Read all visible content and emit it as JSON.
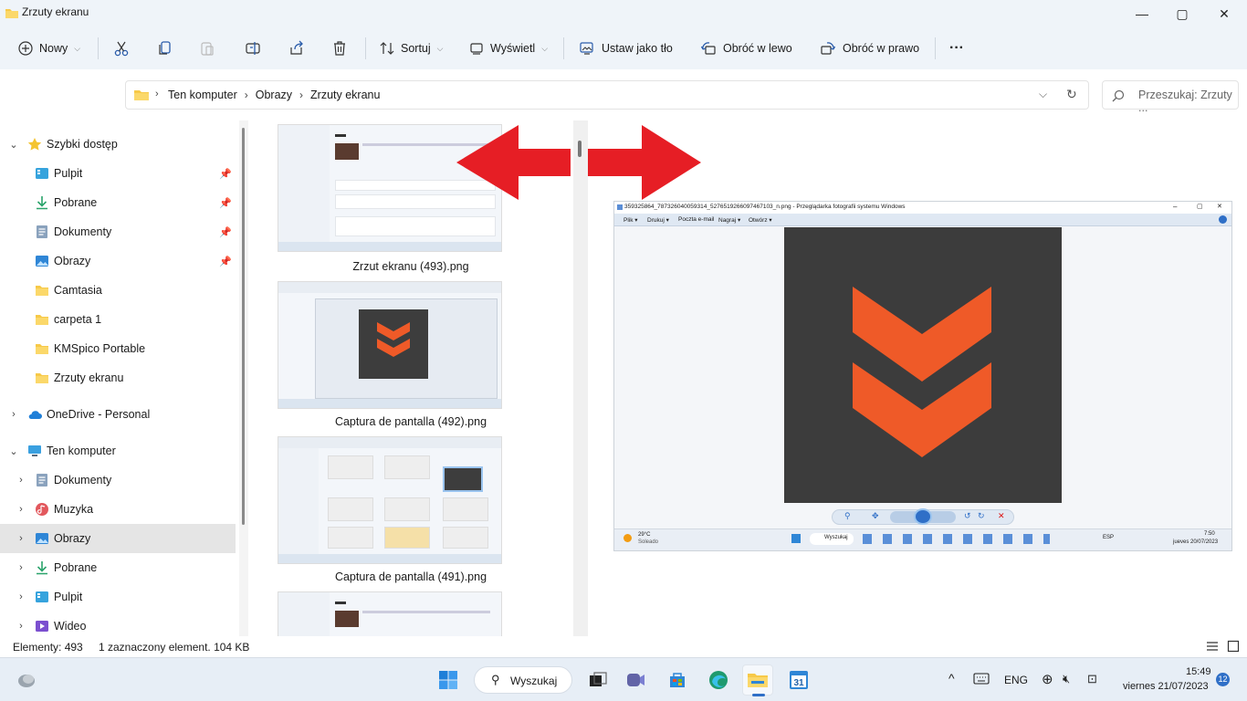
{
  "window": {
    "title": "Zrzuty ekranu",
    "minimize_glyph": "—",
    "maximize_glyph": "▢",
    "close_glyph": "✕"
  },
  "toolbar": {
    "new_label": "Nowy",
    "sort_label": "Sortuj",
    "view_label": "Wyświetl",
    "set_background_label": "Ustaw jako tło",
    "rotate_left_label": "Obróć w lewo",
    "rotate_right_label": "Obróć w prawo",
    "more_label": "···"
  },
  "address": {
    "crumbs": [
      "Ten komputer",
      "Obrazy",
      "Zrzuty ekranu"
    ],
    "search_placeholder": "Przeszukaj: Zrzuty ..."
  },
  "sidebar": {
    "quick_access": {
      "label": "Szybki dostęp",
      "items": [
        {
          "label": "Pulpit",
          "icon": "desktop-icon",
          "pinned": true
        },
        {
          "label": "Pobrane",
          "icon": "download-icon",
          "pinned": true
        },
        {
          "label": "Dokumenty",
          "icon": "documents-icon",
          "pinned": true
        },
        {
          "label": "Obrazy",
          "icon": "pictures-icon",
          "pinned": true
        },
        {
          "label": "Camtasia",
          "icon": "folder-icon",
          "pinned": false
        },
        {
          "label": "carpeta 1",
          "icon": "folder-icon",
          "pinned": false
        },
        {
          "label": "KMSpico Portable",
          "icon": "folder-icon",
          "pinned": false
        },
        {
          "label": "Zrzuty ekranu",
          "icon": "folder-icon",
          "pinned": false
        }
      ]
    },
    "onedrive": {
      "label": "OneDrive - Personal"
    },
    "this_pc": {
      "label": "Ten komputer",
      "items": [
        {
          "label": "Dokumenty",
          "icon": "documents-icon"
        },
        {
          "label": "Muzyka",
          "icon": "music-icon"
        },
        {
          "label": "Obrazy",
          "icon": "pictures-icon",
          "selected": true
        },
        {
          "label": "Pobrane",
          "icon": "download-icon"
        },
        {
          "label": "Pulpit",
          "icon": "desktop-icon"
        },
        {
          "label": "Wideo",
          "icon": "video-icon"
        }
      ]
    }
  },
  "files": [
    {
      "name": "Zrzut ekranu (493).png"
    },
    {
      "name": "Captura de pantalla (492).png"
    },
    {
      "name": "Captura de pantalla (491).png"
    },
    {
      "name": ""
    }
  ],
  "preview": {
    "viewer_title": "359325864_787326040059314_5276519266097467103_n.png - Przeglądarka fotografii systemu Windows",
    "menu": [
      "Plik ▾",
      "Drukuj ▾",
      "Poczta e-mail",
      "Nagraj ▾",
      "Otwórz ▾"
    ],
    "weather_temp": "29°C",
    "weather_desc": "Soleado",
    "search_label": "Wyszukaj",
    "lang": "ESP",
    "time": "7:50",
    "date": "jueves 20/07/2023",
    "colors": {
      "logo": "#ef5a28",
      "background": "#3c3c3c",
      "arrow": "#e61e25"
    }
  },
  "statusbar": {
    "count": "Elementy: 493",
    "selection": "1 zaznaczony element. 104 KB"
  },
  "taskbar": {
    "search_label": "Wyszukaj",
    "lang": "ENG",
    "time": "15:49",
    "date": "viernes 21/07/2023",
    "notification_count": "12",
    "weather_icon": "cloud-icon"
  }
}
